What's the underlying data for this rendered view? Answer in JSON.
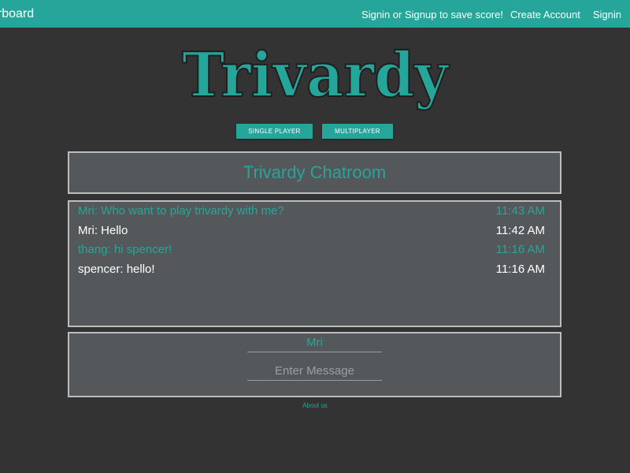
{
  "navbar": {
    "brand": "erboard",
    "links": [
      "Signin or Signup to save score!",
      "Create Account",
      "Signin"
    ]
  },
  "logo": {
    "text": "Trivardy",
    "fill": "#26a69a"
  },
  "modes": {
    "single_label": "SINGLE PLAYER",
    "multi_label": "MULTIPLAYER"
  },
  "chatroom": {
    "title": "Trivardy Chatroom",
    "messages": [
      {
        "text": "Mri: Who want to play trivardy with me?",
        "time": "11:43 AM",
        "color": "teal"
      },
      {
        "text": "Mri: Hello",
        "time": "11:42 AM",
        "color": "white"
      },
      {
        "text": "thang: hi spencer!",
        "time": "11:16 AM",
        "color": "teal"
      },
      {
        "text": "spencer: hello!",
        "time": "11:16 AM",
        "color": "white"
      }
    ],
    "name_value": "Mri",
    "message_placeholder": "Enter Message"
  },
  "footer": {
    "about_label": "About us"
  },
  "colors": {
    "accent": "#26a69a",
    "background": "#333333",
    "panel": "#55585a"
  }
}
